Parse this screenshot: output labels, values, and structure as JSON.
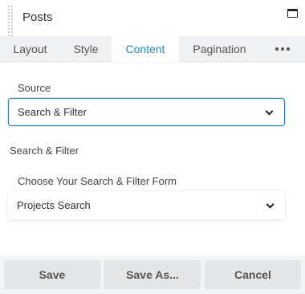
{
  "header": {
    "title": "Posts"
  },
  "tabs": [
    {
      "label": "Layout"
    },
    {
      "label": "Style"
    },
    {
      "label": "Content"
    },
    {
      "label": "Pagination"
    }
  ],
  "active_tab": "Content",
  "content": {
    "source_label": "Source",
    "source_value": "Search & Filter",
    "section_heading": "Search & Filter",
    "form_label": "Choose Your Search & Filter Form",
    "form_value": "Projects Search"
  },
  "footer": {
    "save_label": "Save",
    "save_as_label": "Save As...",
    "cancel_label": "Cancel"
  },
  "colors": {
    "accent": "#1e8cbe",
    "focus_border": "#2a7fb4"
  },
  "icons": [
    "drag-handle-icon",
    "minimize-icon",
    "more-icon",
    "chevron-down-icon"
  ]
}
